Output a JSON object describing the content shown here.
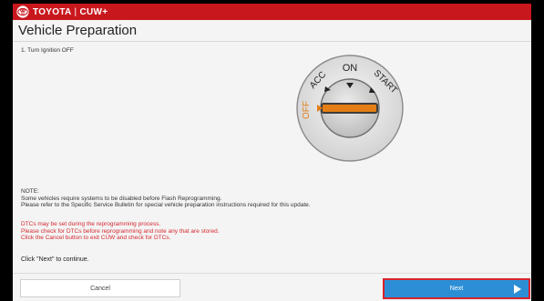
{
  "header": {
    "brand_name": "TOYOTA",
    "separator": "|",
    "app_name": "CUW+",
    "brand_color": "#c8171d"
  },
  "page": {
    "title": "Vehicle Preparation",
    "step": "1. Turn Ignition OFF"
  },
  "ignition_diagram": {
    "labels": [
      "OFF",
      "ACC",
      "ON",
      "START"
    ],
    "selected": "OFF"
  },
  "note": {
    "heading": "NOTE:",
    "lines": [
      "Some vehicles require systems to be disabled before Flash Reprogramming.",
      "Please refer to the Specific Service Bulletin for special vehicle preparation instructions required for this update."
    ]
  },
  "warning": {
    "lines": [
      "DTCs may be set during the reprogramming process.",
      "Please check for DTCs before reprogramming and note any that are stored.",
      "Click the Cancel button to exit CUW and check for DTCs."
    ],
    "color": "#d6282e"
  },
  "continue_text": "Click \"Next\" to continue.",
  "buttons": {
    "cancel": "Cancel",
    "next": "Next",
    "next_color": "#2c8fd6",
    "highlight_color": "#d9232c"
  },
  "icons": {
    "logo": "toyota-logo-icon",
    "next": "play-arrow-icon"
  }
}
